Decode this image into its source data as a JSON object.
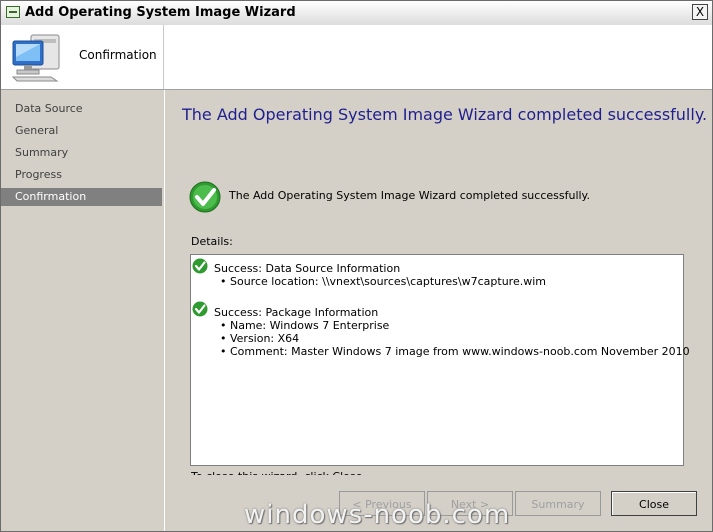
{
  "window": {
    "title": "Add Operating System Image Wizard",
    "close_glyph": "X"
  },
  "header": {
    "title": "Confirmation",
    "icon": "computer-icon"
  },
  "sidebar": {
    "items": [
      {
        "label": "Data Source",
        "active": false
      },
      {
        "label": "General",
        "active": false
      },
      {
        "label": "Summary",
        "active": false
      },
      {
        "label": "Progress",
        "active": false
      },
      {
        "label": "Confirmation",
        "active": true
      }
    ]
  },
  "main": {
    "heading": "The Add Operating System Image Wizard completed successfully.",
    "status_message": "The Add Operating System Image Wizard completed successfully.",
    "details_label": "Details:",
    "details": [
      {
        "title": "Success: Data Source Information",
        "bullets": [
          "• Source location: \\\\vnext\\sources\\captures\\w7capture.wim"
        ]
      },
      {
        "title": "Success: Package Information",
        "bullets": [
          "• Name: Windows 7 Enterprise",
          "• Version: X64",
          "• Comment: Master Windows 7 image from www.windows-noob.com November 2010"
        ]
      }
    ],
    "cutoff_text": "To close this wizard, click Close."
  },
  "buttons": {
    "previous": "< Previous",
    "next": "Next >",
    "summary": "Summary",
    "close": "Close"
  },
  "watermark": "windows-noob.com",
  "colors": {
    "heading": "#1f1f8f",
    "success_green": "#2f9a2f",
    "active_nav": "#808080"
  }
}
